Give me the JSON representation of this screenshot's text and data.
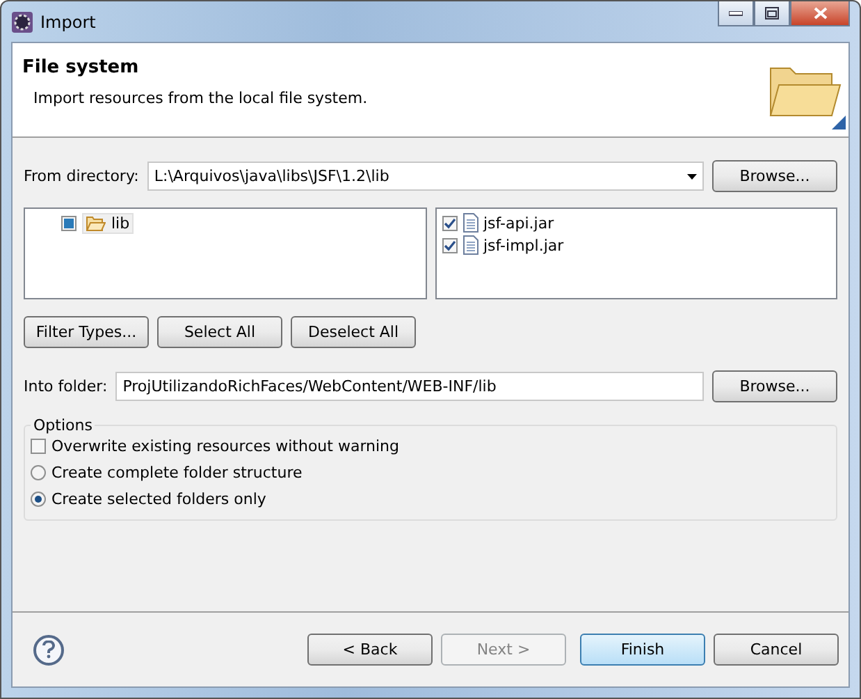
{
  "window": {
    "title": "Import"
  },
  "header": {
    "title": "File system",
    "description": "Import resources from the local file system."
  },
  "from_directory": {
    "label": "From directory:",
    "value": "L:\\Arquivos\\java\\libs\\JSF\\1.2\\lib",
    "browse": "Browse..."
  },
  "folder_tree": [
    {
      "label": "lib",
      "checked": true,
      "partial": true
    }
  ],
  "files": [
    {
      "label": "jsf-api.jar",
      "checked": true
    },
    {
      "label": "jsf-impl.jar",
      "checked": true
    }
  ],
  "selection_buttons": [
    "Filter Types...",
    "Select All",
    "Deselect All"
  ],
  "into_folder": {
    "label": "Into folder:",
    "value": "ProjUtilizandoRichFaces/WebContent/WEB-INF/lib",
    "browse": "Browse..."
  },
  "options": {
    "title": "Options",
    "items": [
      {
        "kind": "checkbox",
        "label": "Overwrite existing resources without warning",
        "checked": false
      },
      {
        "kind": "radio",
        "label": "Create complete folder structure",
        "selected": false
      },
      {
        "kind": "radio",
        "label": "Create selected folders only",
        "selected": true
      }
    ]
  },
  "buttons": [
    {
      "label": "< Back",
      "disabled": false,
      "default": false
    },
    {
      "label": "Next >",
      "disabled": true,
      "default": false
    },
    {
      "label": "Finish",
      "disabled": false,
      "default": true
    },
    {
      "label": "Cancel",
      "disabled": false,
      "default": false
    }
  ]
}
